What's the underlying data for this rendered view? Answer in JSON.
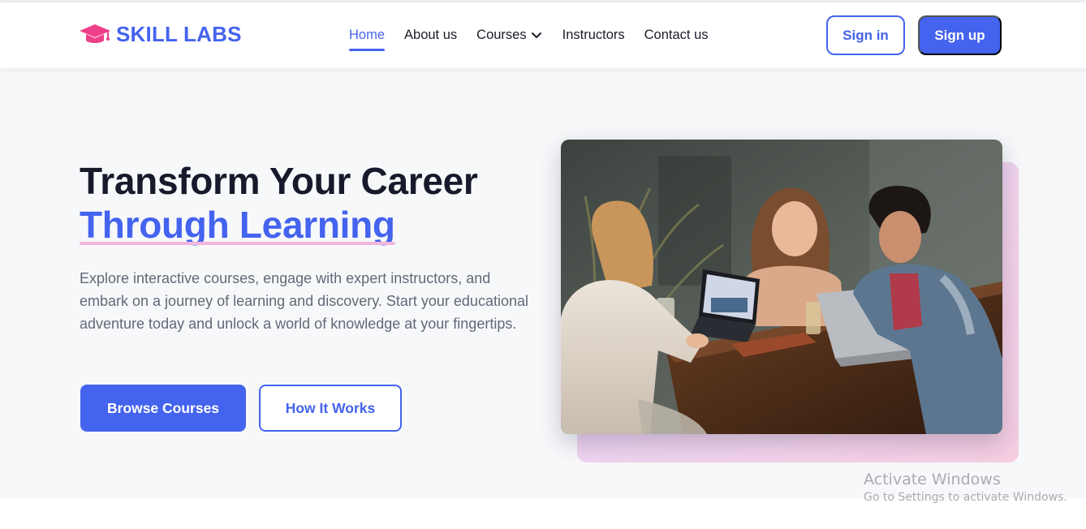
{
  "brand": {
    "name": "SKILL LABS",
    "icon": "graduation-cap-icon",
    "icon_color": "#ee3f8b",
    "color": "#4463ee"
  },
  "nav": {
    "items": [
      {
        "label": "Home",
        "active": true
      },
      {
        "label": "About us",
        "active": false
      },
      {
        "label": "Courses",
        "active": false,
        "dropdown_icon": "chevron-down-icon"
      },
      {
        "label": "Instructors",
        "active": false
      },
      {
        "label": "Contact us",
        "active": false
      }
    ],
    "signin_label": "Sign in",
    "signup_label": "Sign up"
  },
  "hero": {
    "title_line1": "Transform Your Career",
    "title_line2": "Through Learning",
    "description": "Explore interactive courses, engage with expert instructors, and embark on a journey of learning and discovery. Start your educational adventure today and unlock a world of knowledge at your fingertips.",
    "primary_button": "Browse Courses",
    "secondary_button": "How It Works",
    "image": "students-studying-photo"
  },
  "watermark": {
    "title": "Activate Windows",
    "subtitle": "Go to Settings to activate Windows."
  },
  "colors": {
    "accent": "#4463ee",
    "heading": "#161a2b",
    "underline": "#f2b6dd",
    "hero_bg": "#f7f8fa"
  }
}
